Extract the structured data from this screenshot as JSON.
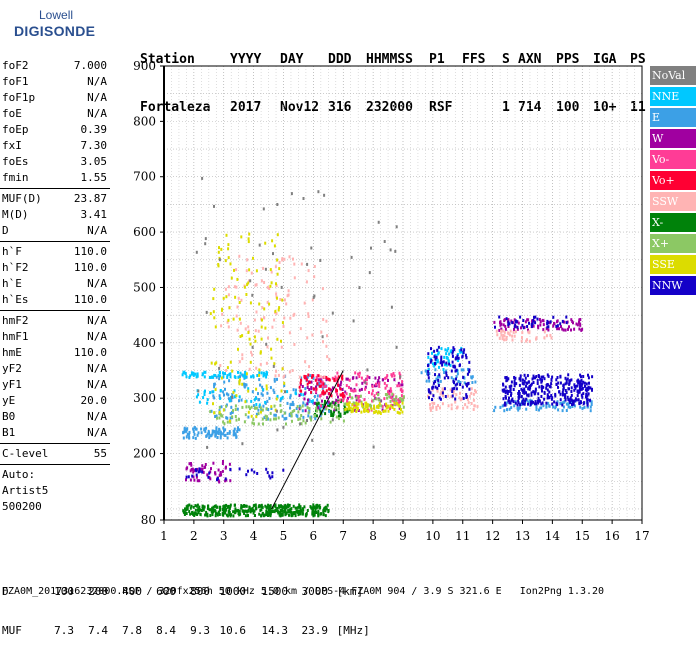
{
  "logo": {
    "line1": "Lowell",
    "line2": "DIGISONDE"
  },
  "header": {
    "labels": [
      "Station",
      "YYYY",
      "DAY",
      "DDD",
      "HHMMSS",
      "P1",
      "FFS",
      "S",
      "AXN",
      "PPS",
      "IGA",
      "PS"
    ],
    "values": [
      "Fortaleza",
      "2017",
      "Nov12",
      "316",
      "232000",
      "RSF",
      "",
      "1",
      "714",
      "100",
      "10+",
      "11"
    ]
  },
  "params": [
    {
      "group": [
        {
          "k": "foF2",
          "v": "7.000"
        },
        {
          "k": "foF1",
          "v": "N/A"
        },
        {
          "k": "foF1p",
          "v": "N/A"
        },
        {
          "k": "foE",
          "v": "N/A"
        },
        {
          "k": "foEp",
          "v": "0.39"
        },
        {
          "k": "fxI",
          "v": "7.30"
        },
        {
          "k": "foEs",
          "v": "3.05"
        },
        {
          "k": "fmin",
          "v": "1.55"
        }
      ]
    },
    {
      "group": [
        {
          "k": "MUF(D)",
          "v": "23.87"
        },
        {
          "k": "M(D)",
          "v": "3.41"
        },
        {
          "k": "D",
          "v": "N/A"
        }
      ]
    },
    {
      "group": [
        {
          "k": "h`F",
          "v": "110.0"
        },
        {
          "k": "h`F2",
          "v": "110.0"
        },
        {
          "k": "h`E",
          "v": "N/A"
        },
        {
          "k": "h`Es",
          "v": "110.0"
        }
      ]
    },
    {
      "group": [
        {
          "k": "hmF2",
          "v": "N/A"
        },
        {
          "k": "hmF1",
          "v": "N/A"
        },
        {
          "k": "hmE",
          "v": "110.0"
        },
        {
          "k": "yF2",
          "v": "N/A"
        },
        {
          "k": "yF1",
          "v": "N/A"
        },
        {
          "k": "yE",
          "v": "20.0"
        },
        {
          "k": "B0",
          "v": "N/A"
        },
        {
          "k": "B1",
          "v": "N/A"
        }
      ]
    },
    {
      "group": [
        {
          "k": "C-level",
          "v": "55"
        }
      ]
    }
  ],
  "auto": {
    "line1": "Auto:",
    "line2": "Artist5",
    "line3": "500200"
  },
  "legend": [
    {
      "label": "NoVal",
      "color": "#808080"
    },
    {
      "label": "NNE",
      "color": "#00c8ff"
    },
    {
      "label": "E",
      "color": "#3ca0e6"
    },
    {
      "label": "W",
      "color": "#a000a0"
    },
    {
      "label": "Vo-",
      "color": "#ff3c96"
    },
    {
      "label": "Vo+",
      "color": "#ff0033"
    },
    {
      "label": "SSW",
      "color": "#ffb4b4"
    },
    {
      "label": "X-",
      "color": "#00820a"
    },
    {
      "label": "X+",
      "color": "#8cc864"
    },
    {
      "label": "SSE",
      "color": "#dcdc00"
    },
    {
      "label": "NNW",
      "color": "#1400c8"
    }
  ],
  "footer": {
    "d_label": "D",
    "d_values": [
      "100",
      "200",
      "400",
      "600",
      "800",
      "1000",
      "1500",
      "3000"
    ],
    "d_unit": "[km]",
    "muf_label": "MUF",
    "muf_values": [
      "7.3",
      "7.4",
      "7.8",
      "8.4",
      "9.3",
      "10.6",
      "14.3",
      "23.9"
    ],
    "muf_unit": "[MHz]",
    "fileinfo": "FZA0M_2017316232000.RSF / 320fx256h 50 kHz 5.0 km / DPS-4 FZA0M 904 / 3.9 S 321.6 E   Ion2Png 1.3.20"
  },
  "chart_data": {
    "type": "scatter",
    "title": "",
    "xlabel": "",
    "ylabel": "",
    "xlim": [
      1,
      17
    ],
    "ylim": [
      80,
      900
    ],
    "xticks": [
      1,
      2,
      3,
      4,
      5,
      6,
      7,
      8,
      9,
      10,
      11,
      12,
      13,
      14,
      15,
      16,
      17
    ],
    "yticks": [
      80,
      200,
      300,
      400,
      500,
      600,
      700,
      800,
      900
    ],
    "grid": true,
    "legend_position": "right",
    "profile_line": {
      "x": [
        4.6,
        7.0
      ],
      "y": [
        100,
        350
      ]
    },
    "series": [
      {
        "name": "X-",
        "color": "#00820a",
        "clusters": [
          {
            "x": [
              1.6,
              6.5
            ],
            "y": [
              90,
              110
            ],
            "n": 380
          },
          {
            "x": [
              6.0,
              7.2
            ],
            "y": [
              270,
              300
            ],
            "n": 60
          }
        ]
      },
      {
        "name": "E",
        "color": "#3ca0e6",
        "clusters": [
          {
            "x": [
              1.6,
              3.5
            ],
            "y": [
              230,
              250
            ],
            "n": 90
          },
          {
            "x": [
              2.5,
              6.5
            ],
            "y": [
              265,
              345
            ],
            "n": 160
          },
          {
            "x": [
              12.0,
              15.3
            ],
            "y": [
              280,
              300
            ],
            "n": 80
          },
          {
            "x": [
              9.5,
              11.5
            ],
            "y": [
              330,
              355
            ],
            "n": 40
          }
        ]
      },
      {
        "name": "NNE",
        "color": "#00c8ff",
        "clusters": [
          {
            "x": [
              1.5,
              4.5
            ],
            "y": [
              340,
              350
            ],
            "n": 70
          },
          {
            "x": [
              9.8,
              11.0
            ],
            "y": [
              350,
              395
            ],
            "n": 50
          },
          {
            "x": [
              2.0,
              6.0
            ],
            "y": [
              290,
              320
            ],
            "n": 40
          }
        ]
      },
      {
        "name": "W",
        "color": "#a000a0",
        "clusters": [
          {
            "x": [
              1.7,
              3.2
            ],
            "y": [
              150,
              190
            ],
            "n": 50
          },
          {
            "x": [
              5.5,
              9.0
            ],
            "y": [
              280,
              340
            ],
            "n": 100
          },
          {
            "x": [
              12.0,
              15.0
            ],
            "y": [
              425,
              445
            ],
            "n": 80
          }
        ]
      },
      {
        "name": "Vo-",
        "color": "#ff3c96",
        "clusters": [
          {
            "x": [
              6.0,
              9.0
            ],
            "y": [
              280,
              350
            ],
            "n": 120
          }
        ]
      },
      {
        "name": "Vo+",
        "color": "#ff0033",
        "clusters": [
          {
            "x": [
              5.5,
              7.0
            ],
            "y": [
              305,
              345
            ],
            "n": 60
          }
        ]
      },
      {
        "name": "SSW",
        "color": "#ffb4b4",
        "clusters": [
          {
            "x": [
              2.8,
              6.5
            ],
            "y": [
              340,
              560
            ],
            "n": 120
          },
          {
            "x": [
              9.8,
              11.5
            ],
            "y": [
              280,
              320
            ],
            "n": 60
          },
          {
            "x": [
              12.0,
              14.0
            ],
            "y": [
              405,
              425
            ],
            "n": 40
          }
        ]
      },
      {
        "name": "X+",
        "color": "#8cc864",
        "clusters": [
          {
            "x": [
              2.5,
              7.0
            ],
            "y": [
              255,
              290
            ],
            "n": 90
          },
          {
            "x": [
              7.0,
              9.0
            ],
            "y": [
              285,
              310
            ],
            "n": 40
          }
        ]
      },
      {
        "name": "SSE",
        "color": "#dcdc00",
        "clusters": [
          {
            "x": [
              2.5,
              5.0
            ],
            "y": [
              260,
              600
            ],
            "n": 120
          },
          {
            "x": [
              7.0,
              9.0
            ],
            "y": [
              275,
              295
            ],
            "n": 80
          }
        ]
      },
      {
        "name": "NNW",
        "color": "#1400c8",
        "clusters": [
          {
            "x": [
              9.8,
              11.2
            ],
            "y": [
              300,
              395
            ],
            "n": 110
          },
          {
            "x": [
              12.3,
              15.3
            ],
            "y": [
              290,
              345
            ],
            "n": 320
          },
          {
            "x": [
              1.7,
              5.0
            ],
            "y": [
              155,
              175
            ],
            "n": 30
          },
          {
            "x": [
              12.0,
              14.5
            ],
            "y": [
              430,
              450
            ],
            "n": 40
          }
        ]
      },
      {
        "name": "NoVal",
        "color": "#808080",
        "clusters": [
          {
            "x": [
              2.0,
              9.0
            ],
            "y": [
              200,
              700
            ],
            "n": 60
          }
        ]
      }
    ]
  }
}
